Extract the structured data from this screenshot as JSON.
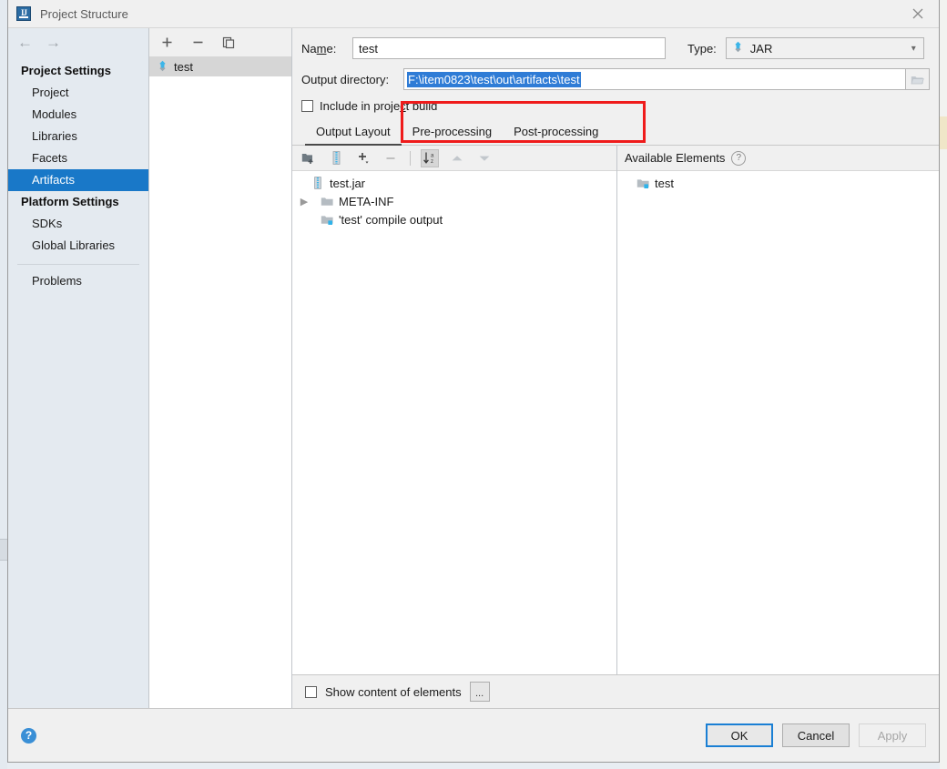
{
  "window": {
    "title": "Project Structure",
    "app_icon": "intellij-idea-icon",
    "close_icon": "close-icon"
  },
  "sidebar": {
    "back_icon": "arrow-left-icon",
    "forward_icon": "arrow-right-icon",
    "groups": [
      {
        "label": "Project Settings",
        "items": [
          {
            "label": "Project",
            "selected": false
          },
          {
            "label": "Modules",
            "selected": false
          },
          {
            "label": "Libraries",
            "selected": false
          },
          {
            "label": "Facets",
            "selected": false
          },
          {
            "label": "Artifacts",
            "selected": true
          }
        ]
      },
      {
        "label": "Platform Settings",
        "items": [
          {
            "label": "SDKs",
            "selected": false
          },
          {
            "label": "Global Libraries",
            "selected": false
          }
        ]
      }
    ],
    "problems": {
      "label": "Problems",
      "selected": false
    }
  },
  "artifacts_panel": {
    "toolbar": [
      {
        "name": "add-artifact-button",
        "glyph": "+"
      },
      {
        "name": "remove-artifact-button",
        "glyph": "−"
      },
      {
        "name": "copy-artifact-button",
        "glyph": "copy-icon"
      }
    ],
    "items": [
      {
        "label": "test",
        "icon": "artifact-jar-icon",
        "selected": true
      }
    ]
  },
  "form": {
    "name_label": "Name:",
    "name_value": "test",
    "type_label": "Type:",
    "type_value": "JAR",
    "type_icon": "artifact-jar-icon",
    "type_caret_icon": "chevron-down-icon",
    "output_directory_label": "Output directory:",
    "output_directory_value": "F:\\item0823\\test\\out\\artifacts\\test",
    "output_directory_selected": true,
    "browse_icon": "folder-browse-icon",
    "include_in_build_label": "Include in project build",
    "include_in_build_checked": false,
    "annotation_color": "#ef1b1b"
  },
  "tabs": [
    {
      "label": "Output Layout",
      "active": true
    },
    {
      "label": "Pre-processing",
      "active": false
    },
    {
      "label": "Post-processing",
      "active": false
    }
  ],
  "output_layout": {
    "toolbar": [
      {
        "name": "add-directory-icon",
        "enabled": true,
        "toggled": false
      },
      {
        "name": "add-archive-icon",
        "enabled": true,
        "toggled": false
      },
      {
        "name": "add-element-icon",
        "enabled": true,
        "toggled": false
      },
      {
        "name": "remove-element-icon",
        "enabled": false,
        "toggled": false
      },
      {
        "name": "sort-alphabetically-icon",
        "enabled": true,
        "toggled": true
      },
      {
        "name": "move-up-icon",
        "enabled": false,
        "toggled": false
      },
      {
        "name": "move-down-icon",
        "enabled": false,
        "toggled": false
      }
    ],
    "tree": [
      {
        "label": "test.jar",
        "icon": "archive-icon",
        "indent": 0,
        "chevron": "none"
      },
      {
        "label": "META-INF",
        "icon": "folder-icon",
        "indent": 1,
        "chevron": "collapsed"
      },
      {
        "label": "'test' compile output",
        "icon": "module-output-icon",
        "indent": 1,
        "chevron": "none"
      }
    ]
  },
  "available_elements": {
    "title": "Available Elements",
    "help_icon": "help-circle-icon",
    "help_glyph": "?",
    "items": [
      {
        "label": "test",
        "icon": "module-output-icon"
      }
    ]
  },
  "show_content": {
    "label": "Show content of elements",
    "checked": false,
    "ellipsis_label": "...",
    "ellipsis_icon": "ellipsis-button"
  },
  "footer": {
    "help_glyph": "?",
    "help_icon": "help-circle-icon",
    "ok_label": "OK",
    "cancel_label": "Cancel",
    "apply_label": "Apply",
    "apply_enabled": false,
    "focus_color": "#1a7fd4"
  }
}
